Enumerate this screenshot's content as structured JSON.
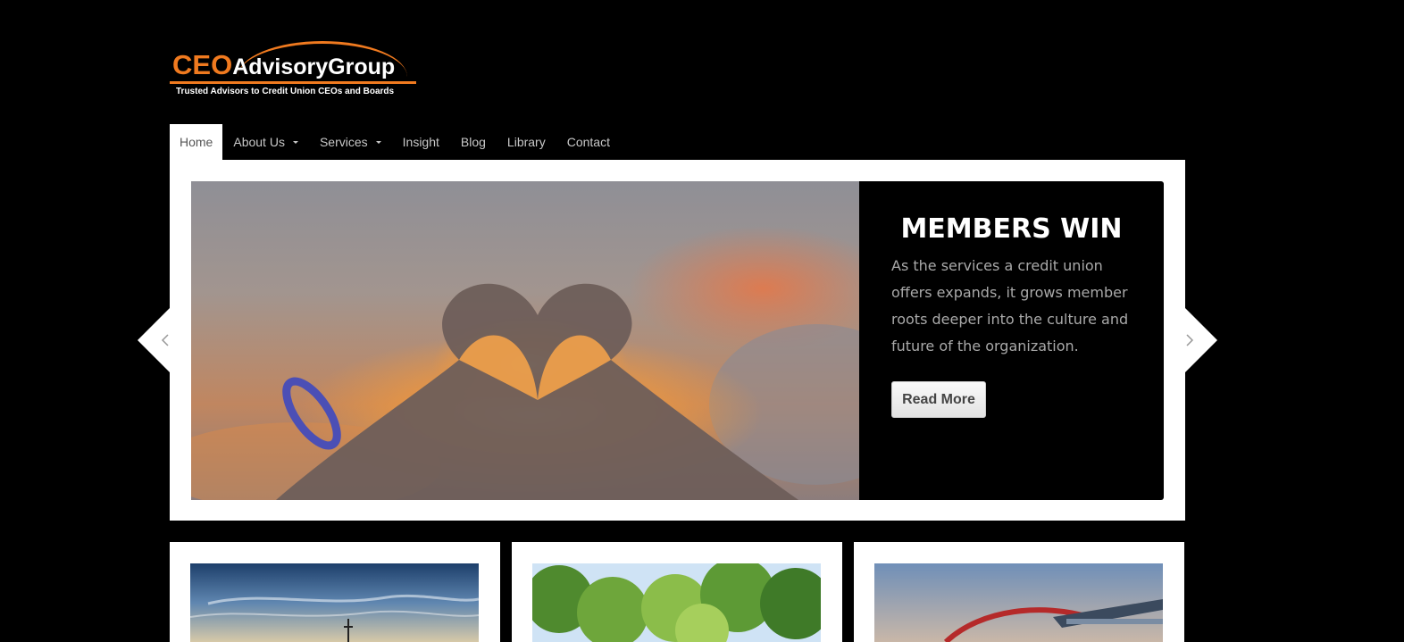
{
  "logo": {
    "ceo_text": "CEO",
    "rest_text": "AdvisoryGroup",
    "tagline": "Trusted Advisors to Credit Union CEOs and Boards",
    "accent_color": "#f07a1f"
  },
  "nav": {
    "items": [
      {
        "label": "Home",
        "active": true,
        "dropdown": false
      },
      {
        "label": "About Us",
        "active": false,
        "dropdown": true
      },
      {
        "label": "Services",
        "active": false,
        "dropdown": true
      },
      {
        "label": "Insight",
        "active": false,
        "dropdown": false
      },
      {
        "label": "Blog",
        "active": false,
        "dropdown": false
      },
      {
        "label": "Library",
        "active": false,
        "dropdown": false
      },
      {
        "label": "Contact",
        "active": false,
        "dropdown": false
      }
    ]
  },
  "slider": {
    "image": "heart-hands-sunset",
    "title": "MEMBERS WIN",
    "text": "As the services a credit union offers expands, it grows member roots deeper into the culture and future of the organization.",
    "button_label": "Read More",
    "prev_icon": "chevron-left-icon",
    "next_icon": "chevron-right-icon"
  },
  "cards": [
    {
      "image": "sky-sunset-landscape"
    },
    {
      "image": "green-trees"
    },
    {
      "image": "red-arch-bridge"
    }
  ]
}
